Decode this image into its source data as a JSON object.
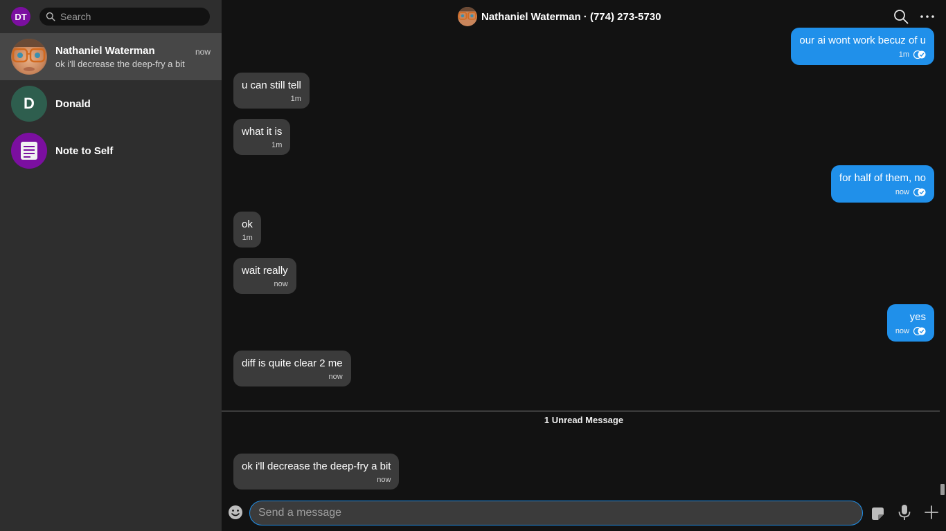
{
  "sidebar": {
    "user_initials": "DT",
    "search_placeholder": "Search",
    "conversations": [
      {
        "name": "Nathaniel Waterman",
        "time": "now",
        "snippet": "ok i'll decrease the deep-fry a bit",
        "active": true
      },
      {
        "name": "Donald",
        "initial": "D"
      },
      {
        "name": "Note to Self"
      }
    ]
  },
  "header": {
    "title": "Nathaniel Waterman · (774) 273-5730"
  },
  "messages": [
    {
      "direction": "out",
      "text": "our ai wont work becuz of u",
      "time": "1m"
    },
    {
      "direction": "in",
      "text": "u can still tell",
      "time": "1m"
    },
    {
      "direction": "in",
      "text": "what it is",
      "time": "1m"
    },
    {
      "direction": "out",
      "text": "for half of them, no",
      "time": "now"
    },
    {
      "direction": "in",
      "text": "ok",
      "time": "1m"
    },
    {
      "direction": "in",
      "text": "wait really",
      "time": "now"
    },
    {
      "direction": "out",
      "text": "yes",
      "time": "now"
    },
    {
      "direction": "in",
      "text": "diff is quite clear 2 me",
      "time": "now"
    },
    {
      "direction": "in",
      "text": "ok i'll decrease the deep-fry a bit",
      "time": "now"
    }
  ],
  "unread_label": "1 Unread Message",
  "composer": {
    "placeholder": "Send a message"
  },
  "colors": {
    "accent": "#2090ea",
    "incoming_bubble": "#3b3b3b",
    "sidebar_bg": "#2e2e2e",
    "main_bg": "#121212",
    "user_avatar": "#7b0fa0",
    "donald_avatar": "#2e5e4e",
    "note_avatar": "#7b0fa0"
  },
  "icons": {
    "search": "search-icon",
    "more": "more-icon",
    "emoji": "emoji-icon",
    "sticker": "sticker-icon",
    "mic": "mic-icon",
    "plus": "plus-icon",
    "delivered": "read-check-icon",
    "note": "note-icon"
  }
}
